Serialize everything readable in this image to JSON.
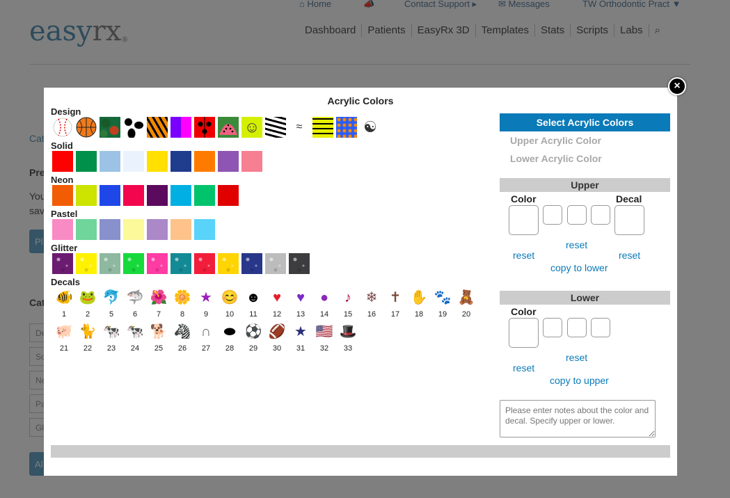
{
  "topnav": {
    "home": "Home",
    "contact": "Contact Support",
    "messages": "Messages",
    "practice": "TW Orthodontic Pract"
  },
  "logo": {
    "easy": "easy",
    "rx": "rx",
    "reg": "®"
  },
  "mainnav": [
    "Dashboard",
    "Patients",
    "EasyRx 3D",
    "Templates",
    "Stats",
    "Scripts",
    "Labs"
  ],
  "background": {
    "cat": "Cat",
    "pre": "Pre",
    "you": "You",
    "sav": "sav",
    "pl": "Pl",
    "cat2": "Cat",
    "de": "De",
    "so": "So",
    "ne": "Ne",
    "pa": "Pa",
    "gl": "Gl",
    "al": "Al"
  },
  "modal": {
    "title": "Acrylic Colors",
    "sections": {
      "design": "Design",
      "solid": "Solid",
      "neon": "Neon",
      "pastel": "Pastel",
      "glitter": "Glitter",
      "decals": "Decals"
    },
    "colors": {
      "solid": [
        "#ff0000",
        "#00904a",
        "#9cc3e5",
        "#eaf3fd",
        "#ffe000",
        "#203c8c",
        "#ff7b00",
        "#8f55b3",
        "#f77f92"
      ],
      "neon": [
        "#f25c05",
        "#cde300",
        "#1f47e8",
        "#f2064e",
        "#5b0a5e",
        "#00b0e3",
        "#00c36c",
        "#e00000"
      ],
      "pastel": [
        "#f98bc4",
        "#6fd59b",
        "#8891cc",
        "#fbf99a",
        "#ab88c8",
        "#fdc38a",
        "#59d3fa"
      ],
      "glitter": [
        "#6b1b70",
        "#fff200",
        "#8fb8a0",
        "#17d93b",
        "#ff3ba4",
        "#138a95",
        "#f21d3a",
        "#ffd400",
        "#28378a",
        "#bcbcbc",
        "#3d3d40"
      ]
    },
    "decals_row1": [
      {
        "num": "1",
        "icon": "fish-icon",
        "glyph": "🐠"
      },
      {
        "num": "2",
        "icon": "frog-icon",
        "glyph": "🐸"
      },
      {
        "num": "5",
        "icon": "dolphin-icon",
        "glyph": "🐬"
      },
      {
        "num": "6",
        "icon": "shark-icon",
        "glyph": "🦈"
      },
      {
        "num": "7",
        "icon": "flower-red-icon",
        "glyph": "🌺"
      },
      {
        "num": "8",
        "icon": "flower-green-icon",
        "glyph": "🌼"
      },
      {
        "num": "9",
        "icon": "star-purple-icon",
        "glyph": "★"
      },
      {
        "num": "10",
        "icon": "smiley-yellow-icon",
        "glyph": "😊"
      },
      {
        "num": "11",
        "icon": "smiley-black-icon",
        "glyph": "☻"
      },
      {
        "num": "12",
        "icon": "heart-red-icon",
        "glyph": "♥"
      },
      {
        "num": "13",
        "icon": "heart-purple-icon",
        "glyph": "♥"
      },
      {
        "num": "14",
        "icon": "circle-purple-icon",
        "glyph": "●"
      },
      {
        "num": "15",
        "icon": "music-note-icon",
        "glyph": "♪"
      },
      {
        "num": "16",
        "icon": "snowflake-icon",
        "glyph": "❄"
      },
      {
        "num": "17",
        "icon": "cross-icon",
        "glyph": "✝"
      },
      {
        "num": "18",
        "icon": "hand-icon",
        "glyph": "✋"
      },
      {
        "num": "19",
        "icon": "paw-icon",
        "glyph": "🐾"
      },
      {
        "num": "20",
        "icon": "teddy-bear-icon",
        "glyph": "🧸"
      }
    ],
    "decals_row2": [
      {
        "num": "21",
        "icon": "pig-icon",
        "glyph": "🐖"
      },
      {
        "num": "22",
        "icon": "cat-icon",
        "glyph": "🐈"
      },
      {
        "num": "23",
        "icon": "cow-icon",
        "glyph": "🐄"
      },
      {
        "num": "24",
        "icon": "cow-spotted-icon",
        "glyph": "🐄"
      },
      {
        "num": "25",
        "icon": "dog-icon",
        "glyph": "🐕"
      },
      {
        "num": "26",
        "icon": "zebra-icon",
        "glyph": "🦓"
      },
      {
        "num": "27",
        "icon": "horseshoe-icon",
        "glyph": "∩"
      },
      {
        "num": "28",
        "icon": "hockey-puck-icon",
        "glyph": "⬬"
      },
      {
        "num": "29",
        "icon": "soccer-ball-icon",
        "glyph": "⚽"
      },
      {
        "num": "30",
        "icon": "football-icon",
        "glyph": "🏈"
      },
      {
        "num": "31",
        "icon": "star-usa-icon",
        "glyph": "★"
      },
      {
        "num": "32",
        "icon": "usa-flag-icon",
        "glyph": "🇺🇸"
      },
      {
        "num": "33",
        "icon": "uncle-sam-hat-icon",
        "glyph": "🎩"
      }
    ],
    "right": {
      "select_btn": "Select Acrylic Colors",
      "upper_color": "Upper Acrylic Color",
      "lower_color": "Lower Acrylic Color",
      "upper_hdr": "Upper",
      "lower_hdr": "Lower",
      "color_label": "Color",
      "decal_label": "Decal",
      "reset": "reset",
      "copy_to_lower": "copy to lower",
      "copy_to_upper": "copy to upper",
      "notes_placeholder": "Please enter notes about the color and decal. Specify upper or lower."
    },
    "close": "×"
  }
}
